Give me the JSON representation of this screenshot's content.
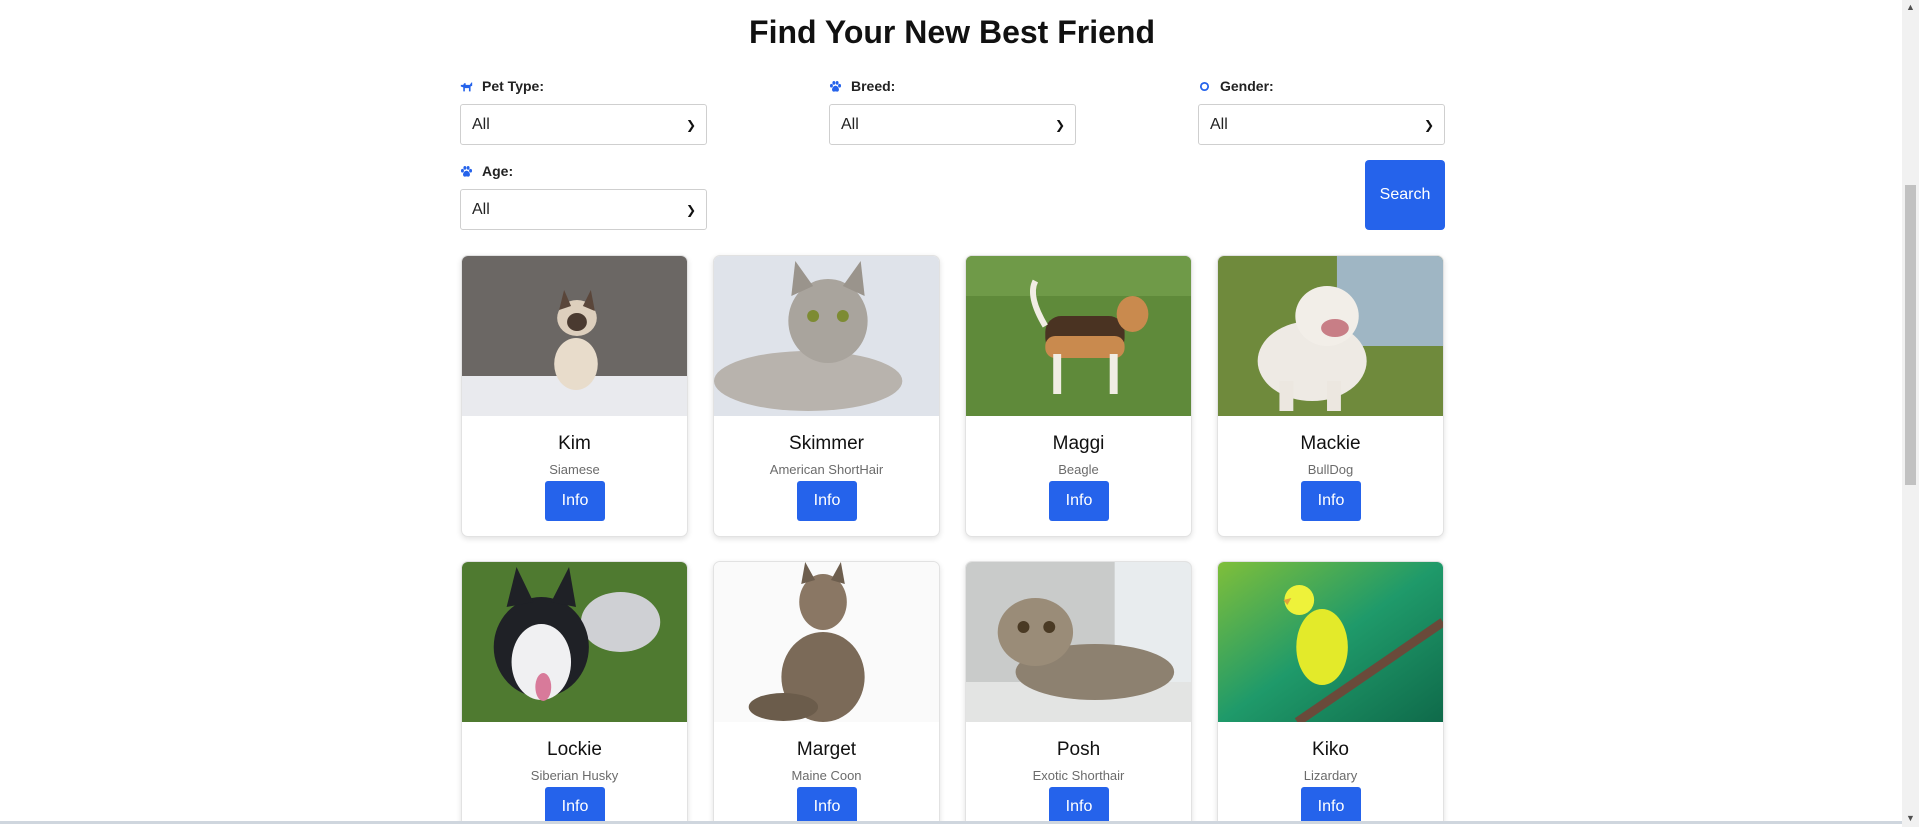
{
  "header": {
    "title": "Find Your New Best Friend"
  },
  "filters": [
    {
      "label": "Pet Type:",
      "value": "All",
      "icon": "dog-icon"
    },
    {
      "label": "Breed:",
      "value": "All",
      "icon": "paw-icon"
    },
    {
      "label": "Gender:",
      "value": "All",
      "icon": "gender-icon"
    },
    {
      "label": "Age:",
      "value": "All",
      "icon": "paw-icon"
    }
  ],
  "search": {
    "label": "Search"
  },
  "pets": [
    {
      "name": "Kim",
      "breed": "Siamese",
      "button": "Info"
    },
    {
      "name": "Skimmer",
      "breed": "American ShortHair",
      "button": "Info"
    },
    {
      "name": "Maggi",
      "breed": "Beagle",
      "button": "Info"
    },
    {
      "name": "Mackie",
      "breed": "BullDog",
      "button": "Info"
    },
    {
      "name": "Lockie",
      "breed": "Siberian Husky",
      "button": "Info"
    },
    {
      "name": "Marget",
      "breed": "Maine Coon",
      "button": "Info"
    },
    {
      "name": "Posh",
      "breed": "Exotic Shorthair",
      "button": "Info"
    },
    {
      "name": "Kiko",
      "breed": "Lizardary",
      "button": "Info"
    }
  ],
  "colors": {
    "accent": "#2563eb"
  }
}
